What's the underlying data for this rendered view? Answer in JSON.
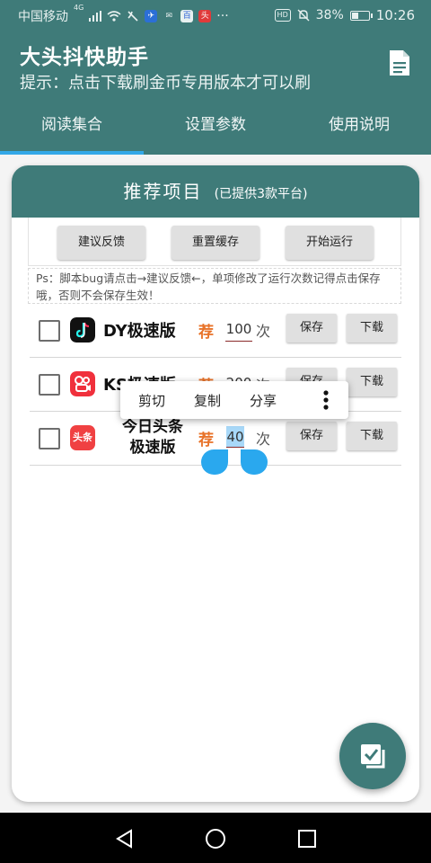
{
  "status_bar": {
    "carrier": "中国移动",
    "network": "4G",
    "battery_percent": "38%",
    "battery_level": 0.38,
    "time": "10:26",
    "hd_badge": "HD"
  },
  "app": {
    "title": "大头抖快助手",
    "subtitle": "提示：点击下载刷金币专用版本才可以刷"
  },
  "tabs": [
    {
      "label": "阅读集合",
      "active": true
    },
    {
      "label": "设置参数",
      "active": false
    },
    {
      "label": "使用说明",
      "active": false
    }
  ],
  "card": {
    "title": "推荐项目",
    "subtitle": "(已提供3款平台)",
    "buttons": {
      "feedback": "建议反馈",
      "reset_cache": "重置缓存",
      "start": "开始运行"
    },
    "ps_note": "Ps：脚本bug请点击→建议反馈←，单项修改了运行次数记得点击保存哦，否则不会保存生效！"
  },
  "items": [
    {
      "name": "DY极速版",
      "rec": "荐",
      "count": "100",
      "unit": "次",
      "save": "保存",
      "download": "下载",
      "logo_icon": "douyin-logo-icon"
    },
    {
      "name": "KS极速版",
      "rec": "荐",
      "count": "200",
      "unit": "次",
      "save": "保存",
      "download": "下载",
      "logo_icon": "kuaishou-logo-icon"
    },
    {
      "name_line1": "今日头条",
      "name_line2": "极速版",
      "rec": "荐",
      "count": "40",
      "unit": "次",
      "save": "保存",
      "download": "下载",
      "logo_icon": "toutiao-logo-icon",
      "logo_text": "头条"
    }
  ],
  "context_menu": {
    "cut": "剪切",
    "copy": "复制",
    "share": "分享"
  },
  "colors": {
    "primary": "#3f7b79",
    "tab_indicator": "#33a8e8",
    "rec": "#e8732a",
    "selection": "#a8d8f8",
    "handle": "#2aa8ee"
  }
}
